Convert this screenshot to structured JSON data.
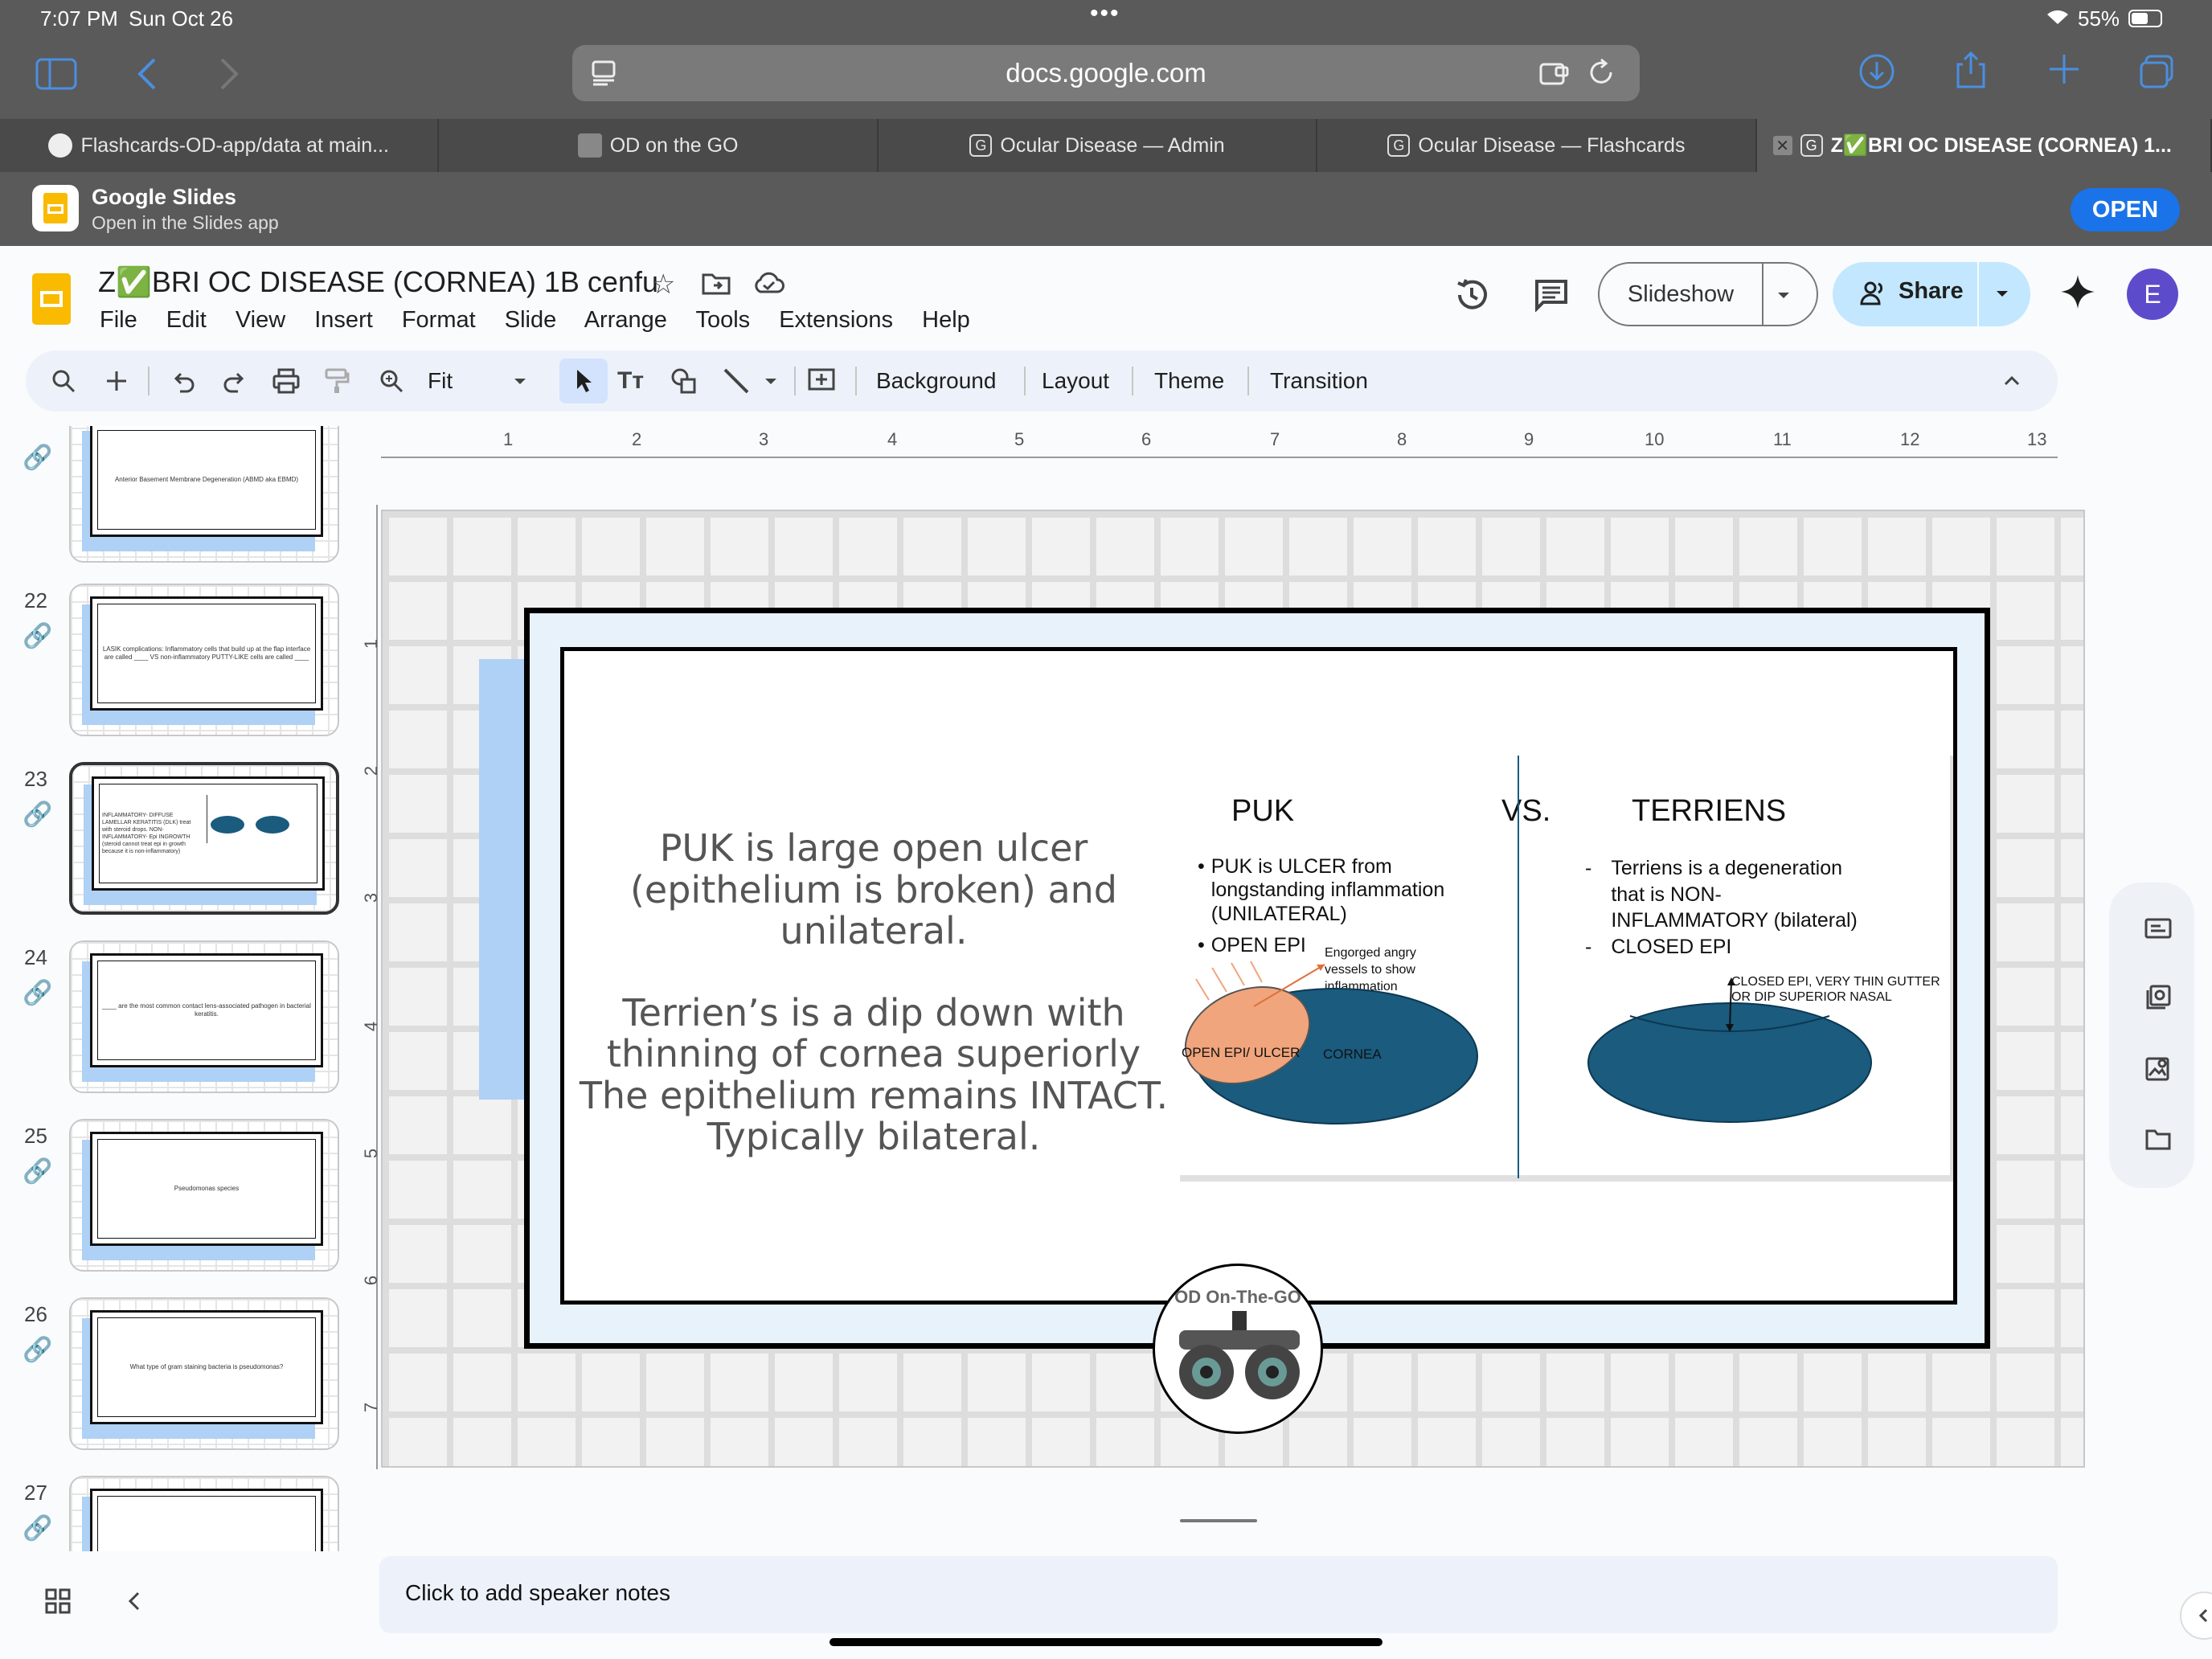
{
  "status": {
    "time": "7:07 PM",
    "date": "Sun Oct 26",
    "battery": "55%"
  },
  "browser": {
    "url": "docs.google.com"
  },
  "tabs": [
    {
      "label": "Flashcards-OD-app/data at main..."
    },
    {
      "label": "OD on the GO"
    },
    {
      "label": "Ocular Disease — Admin"
    },
    {
      "label": "Ocular Disease — Flashcards"
    },
    {
      "label": "Z✅BRI OC DISEASE (CORNEA) 1..."
    }
  ],
  "banner": {
    "app": "Google Slides",
    "sub": "Open in the Slides app",
    "open": "OPEN"
  },
  "doc": {
    "title": "Z✅BRI OC DISEASE (CORNEA) 1B cenfu",
    "avatar": "E"
  },
  "menu": [
    "File",
    "Edit",
    "View",
    "Insert",
    "Format",
    "Slide",
    "Arrange",
    "Tools",
    "Extensions",
    "Help"
  ],
  "header": {
    "slideshow": "Slideshow",
    "share": "Share"
  },
  "toolbar": {
    "zoom": "Fit",
    "background": "Background",
    "layout": "Layout",
    "theme": "Theme",
    "transition": "Transition"
  },
  "ruler": {
    "h": [
      "1",
      "2",
      "3",
      "4",
      "5",
      "6",
      "7",
      "8",
      "9",
      "10",
      "11",
      "12",
      "13"
    ],
    "v": [
      "1",
      "2",
      "3",
      "4",
      "5",
      "6",
      "7"
    ]
  },
  "thumbs": [
    {
      "num": "",
      "text": "Anterior Basement Membrane Degeneration (ABMD aka EBMD)"
    },
    {
      "num": "22",
      "text": "LASIK complications: Inflammatory cells that build up at the flap interface are called ____ VS non-inflammatory PUTTY-LIKE cells are called ____"
    },
    {
      "num": "23",
      "text": "INFLAMMATORY- DIFFUSE LAMELLAR KERATITIS (DLK) treat with steroid drops. NON-INFLAMMATORY- Epi INGROWTH (steroid cannot treat epi in growth because it is non-inflammatory)"
    },
    {
      "num": "24",
      "text": "____ are the most common contact lens-associated pathogen in bacterial keratitis."
    },
    {
      "num": "25",
      "text": "Pseudomonas species"
    },
    {
      "num": "26",
      "text": "What type of gram staining bacteria is pseudomonas?"
    },
    {
      "num": "27",
      "text": ""
    }
  ],
  "slide": {
    "left_text_1": "PUK is large open ulcer (epithelium is broken) and unilateral.",
    "left_text_2": "Terrien’s  is a dip down with thinning of cornea superiorly The epithelium remains INTACT.  Typically bilateral.",
    "puk_title": "PUK",
    "vs": "VS.",
    "terriens_title": "TERRIENS",
    "puk_b1": "PUK is ULCER from longstanding inflammation (UNILATERAL)",
    "puk_b2": "OPEN EPI",
    "puk_note": "Engorged angry vessels to show inflammation",
    "puk_ulcer": "OPEN EPI/ ULCER",
    "puk_cornea": "CORNEA",
    "ter_b1": "Terriens is a degeneration that is NON-INFLAMMATORY (bilateral)",
    "ter_b2": "CLOSED EPI",
    "ter_note": "CLOSED EPI, VERY THIN GUTTER OR DIP SUPERIOR NASAL",
    "logo": "OD On-The-GO"
  },
  "notes": {
    "placeholder": "Click to add speaker notes"
  },
  "colors": {
    "accent": "#0b57d0",
    "cornea": "#1a5b7e",
    "ulcer": "#f0a57c",
    "slide_bg_blue": "#aed1f5"
  }
}
